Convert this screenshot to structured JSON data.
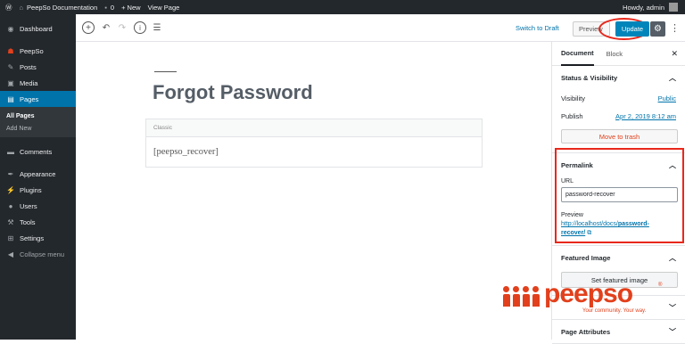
{
  "adminbar": {
    "site_name": "PeepSo Documentation",
    "comments_count": "0",
    "new_label": "+ New",
    "view_page_label": "View Page",
    "howdy": "Howdy, admin"
  },
  "sidebar": {
    "items": [
      {
        "label": "Dashboard",
        "icon": "dashboard-icon"
      },
      {
        "label": "PeepSo",
        "icon": "peepso-icon"
      },
      {
        "label": "Posts",
        "icon": "pin-icon"
      },
      {
        "label": "Media",
        "icon": "media-icon"
      },
      {
        "label": "Pages",
        "icon": "pages-icon"
      },
      {
        "label": "Comments",
        "icon": "comments-icon"
      },
      {
        "label": "Appearance",
        "icon": "appearance-icon"
      },
      {
        "label": "Plugins",
        "icon": "plugins-icon"
      },
      {
        "label": "Users",
        "icon": "users-icon"
      },
      {
        "label": "Tools",
        "icon": "tools-icon"
      },
      {
        "label": "Settings",
        "icon": "settings-icon"
      },
      {
        "label": "Collapse menu",
        "icon": "collapse-icon"
      }
    ],
    "submenu": [
      "All Pages",
      "Add New"
    ]
  },
  "toolbar": {
    "switch_draft": "Switch to Draft",
    "preview": "Preview",
    "update": "Update"
  },
  "editor": {
    "title": "Forgot Password",
    "classic_label": "Classic",
    "classic_content": "[peepso_recover]"
  },
  "panel": {
    "tab_document": "Document",
    "tab_block": "Block",
    "status_heading": "Status & Visibility",
    "visibility_label": "Visibility",
    "visibility_value": "Public",
    "publish_label": "Publish",
    "publish_value": "Apr 2, 2019 8:12 am",
    "trash_label": "Move to trash",
    "permalink_heading": "Permalink",
    "url_label": "URL",
    "url_value": "password-recover",
    "preview_label": "Preview",
    "preview_link_prefix": "http://localhost/docs/",
    "preview_link_slug1": "password-",
    "preview_link_slug2": "recover/",
    "featured_heading": "Featured Image",
    "featured_button": "Set featured image",
    "page_attributes": "Page Attributes"
  },
  "logo": {
    "word": "peepso",
    "registered": "®",
    "tagline": "Your community. Your way."
  },
  "colors": {
    "accent": "#0085ba",
    "highlight": "#e8271b",
    "brand": "#e2401c",
    "admin_dark": "#23282d"
  }
}
